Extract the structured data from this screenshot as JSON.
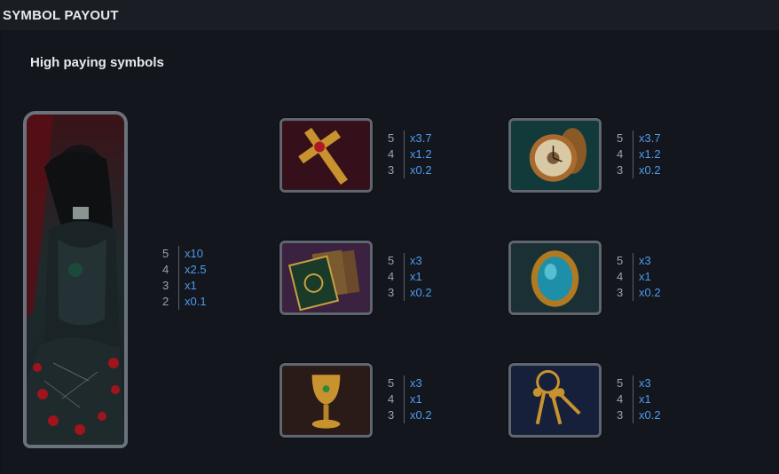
{
  "header": {
    "title": "SYMBOL PAYOUT"
  },
  "section": {
    "title": "High paying symbols"
  },
  "symbols": [
    {
      "name": "vampire-woman",
      "payouts": [
        {
          "count": "5",
          "mult": "x10"
        },
        {
          "count": "4",
          "mult": "x2.5"
        },
        {
          "count": "3",
          "mult": "x1"
        },
        {
          "count": "2",
          "mult": "x0.1"
        }
      ]
    },
    {
      "name": "cross",
      "payouts": [
        {
          "count": "5",
          "mult": "x3.7"
        },
        {
          "count": "4",
          "mult": "x1.2"
        },
        {
          "count": "3",
          "mult": "x0.2"
        }
      ]
    },
    {
      "name": "pocket-watch",
      "payouts": [
        {
          "count": "5",
          "mult": "x3.7"
        },
        {
          "count": "4",
          "mult": "x1.2"
        },
        {
          "count": "3",
          "mult": "x0.2"
        }
      ]
    },
    {
      "name": "tarot-cards",
      "payouts": [
        {
          "count": "5",
          "mult": "x3"
        },
        {
          "count": "4",
          "mult": "x1"
        },
        {
          "count": "3",
          "mult": "x0.2"
        }
      ]
    },
    {
      "name": "gem-brooch",
      "payouts": [
        {
          "count": "5",
          "mult": "x3"
        },
        {
          "count": "4",
          "mult": "x1"
        },
        {
          "count": "3",
          "mult": "x0.2"
        }
      ]
    },
    {
      "name": "goblet",
      "payouts": [
        {
          "count": "5",
          "mult": "x3"
        },
        {
          "count": "4",
          "mult": "x1"
        },
        {
          "count": "3",
          "mult": "x0.2"
        }
      ]
    },
    {
      "name": "keys",
      "payouts": [
        {
          "count": "5",
          "mult": "x3"
        },
        {
          "count": "4",
          "mult": "x1"
        },
        {
          "count": "3",
          "mult": "x0.2"
        }
      ]
    }
  ]
}
